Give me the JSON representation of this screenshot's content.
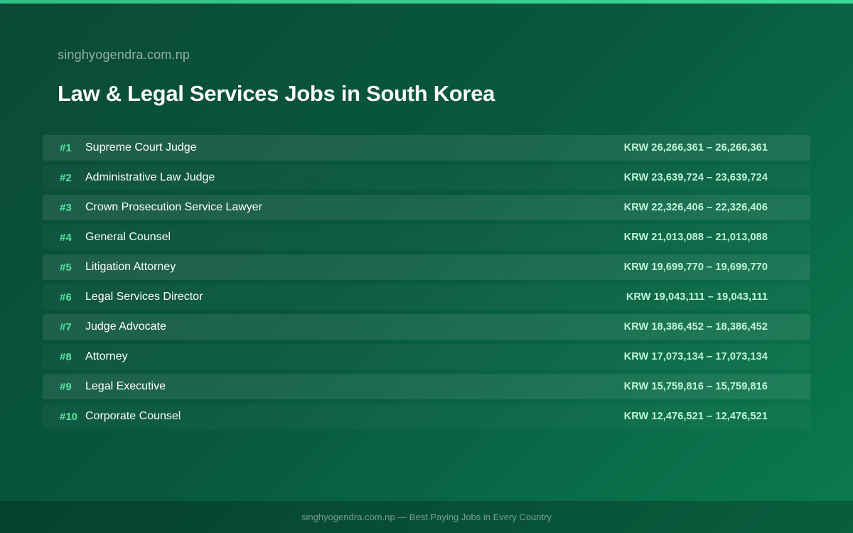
{
  "site_name": "singhyogendra.com.np",
  "title": "Law & Legal Services Jobs in South Korea",
  "jobs": [
    {
      "rank": "#1",
      "title": "Supreme Court Judge",
      "salary": "KRW 26,266,361 – 26,266,361"
    },
    {
      "rank": "#2",
      "title": "Administrative Law Judge",
      "salary": "KRW 23,639,724 – 23,639,724"
    },
    {
      "rank": "#3",
      "title": "Crown Prosecution Service Lawyer",
      "salary": "KRW 22,326,406 – 22,326,406"
    },
    {
      "rank": "#4",
      "title": "General Counsel",
      "salary": "KRW 21,013,088 – 21,013,088"
    },
    {
      "rank": "#5",
      "title": "Litigation Attorney",
      "salary": "KRW 19,699,770 – 19,699,770"
    },
    {
      "rank": "#6",
      "title": "Legal Services Director",
      "salary": "KRW 19,043,111 – 19,043,111"
    },
    {
      "rank": "#7",
      "title": "Judge Advocate",
      "salary": "KRW 18,386,452 – 18,386,452"
    },
    {
      "rank": "#8",
      "title": "Attorney",
      "salary": "KRW 17,073,134 – 17,073,134"
    },
    {
      "rank": "#9",
      "title": "Legal Executive",
      "salary": "KRW 15,759,816 – 15,759,816"
    },
    {
      "rank": "#10",
      "title": "Corporate Counsel",
      "salary": "KRW 12,476,521 – 12,476,521"
    }
  ],
  "footer": "singhyogendra.com.np — Best Paying Jobs in Every Country",
  "colors": {
    "accent": "#4fe3a0",
    "salary": "#bff5da",
    "top_bar": "#3fd896"
  }
}
